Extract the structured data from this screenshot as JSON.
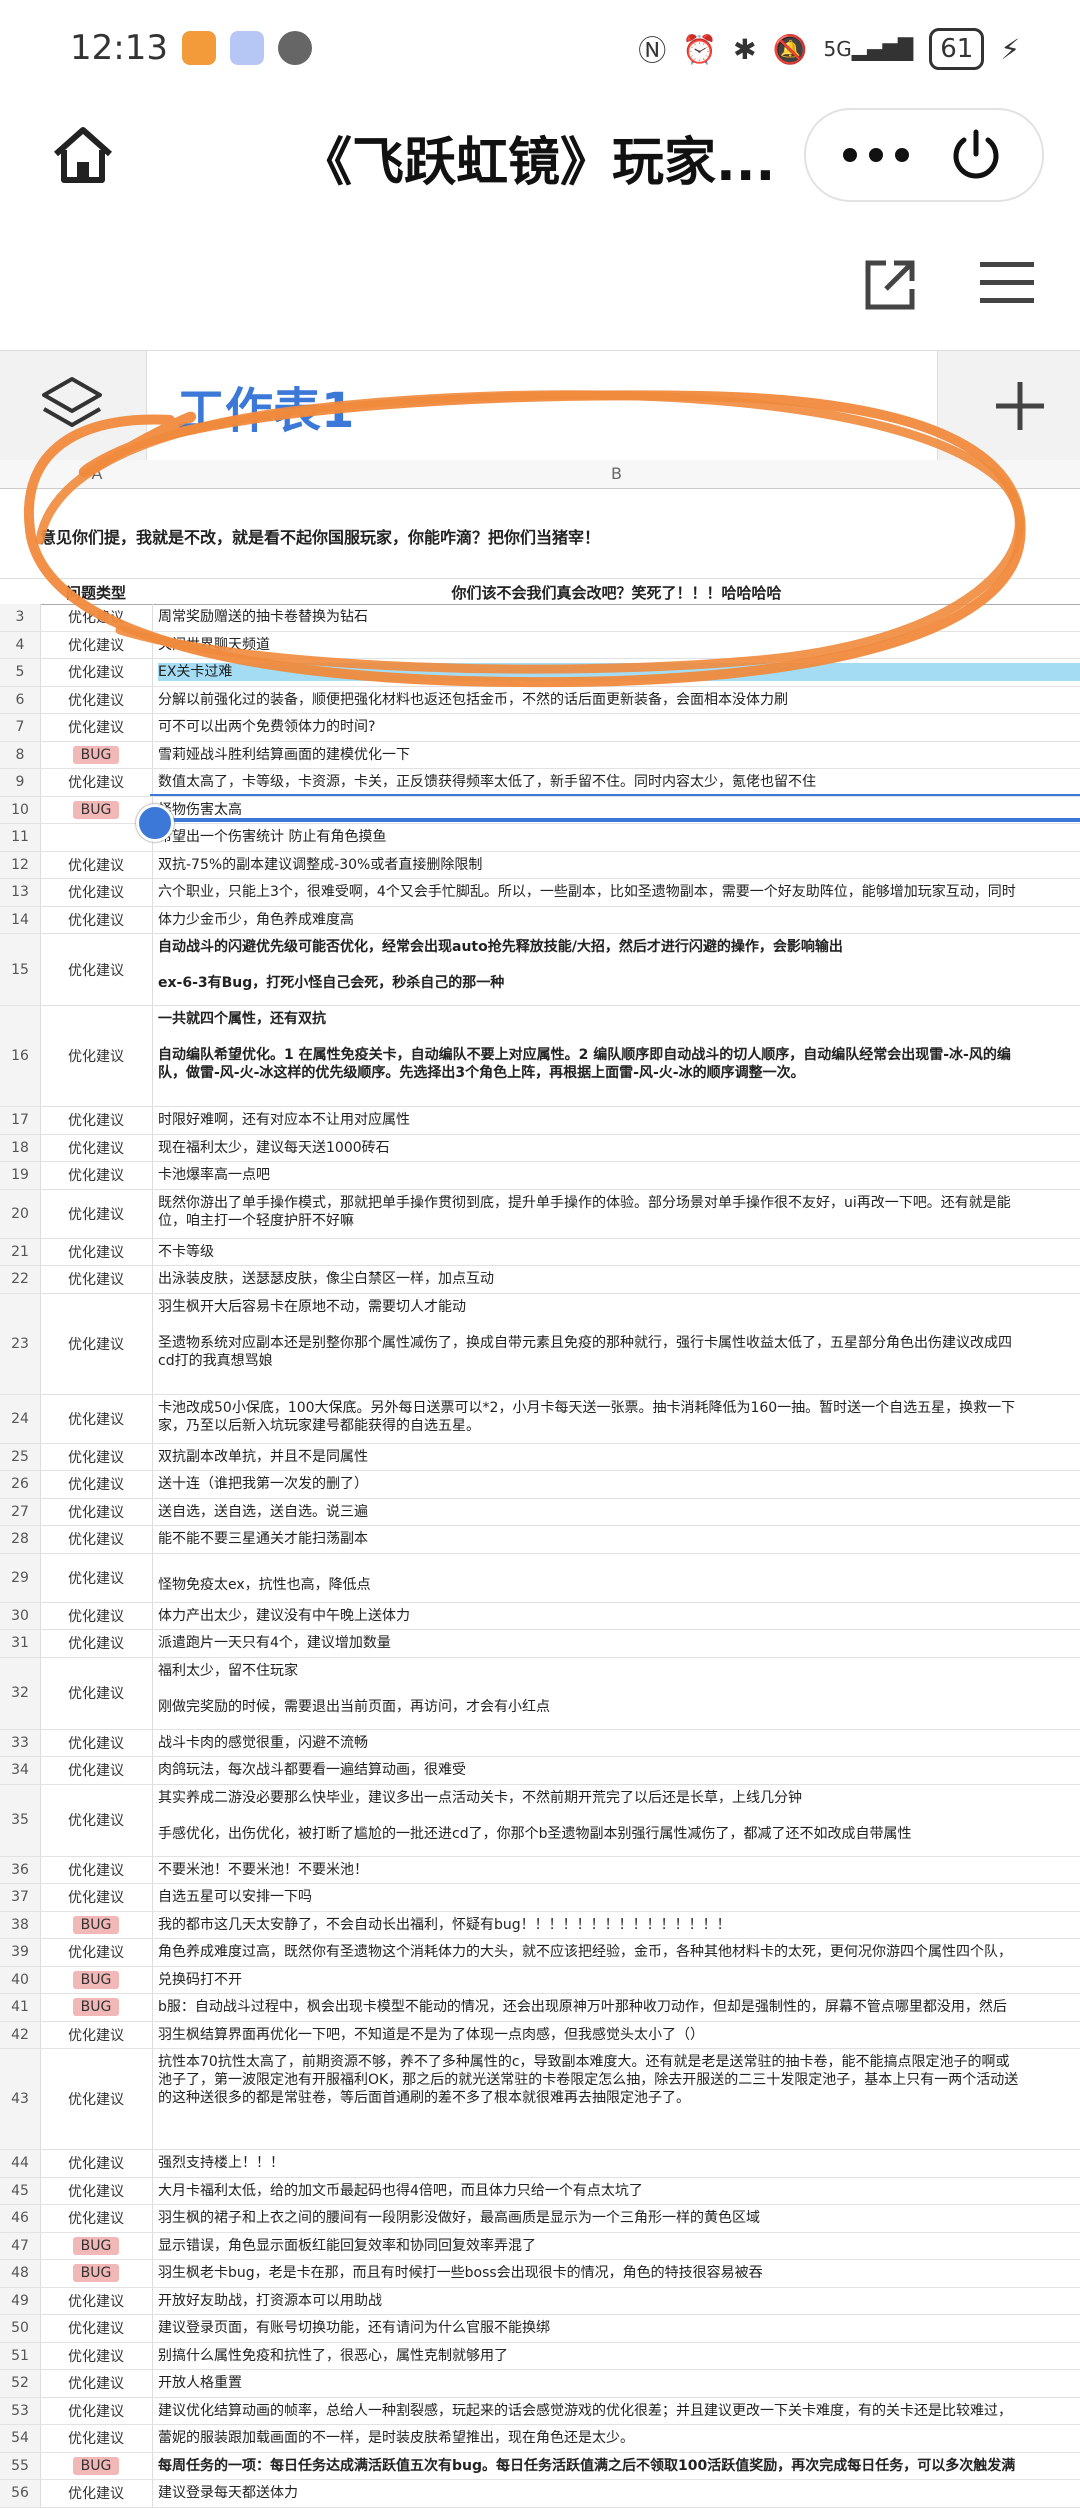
{
  "status": {
    "time": "12:13",
    "signal_label": "5G",
    "battery": "61"
  },
  "header": {
    "title": "《飞跃虹镜》玩家..."
  },
  "tabs": {
    "sheet_label": "工作表1"
  },
  "columns": {
    "a": "A",
    "b": "B"
  },
  "notice": "意见你们提，我就是不改，就是看不起你国服玩家，你能咋滴？把你们当猪宰！",
  "table_header": {
    "type": "问题类型",
    "content": "你们该不会我们真会改吧？笑死了！！！哈哈哈哈"
  },
  "rows": [
    {
      "n": "3",
      "type": "优化建议",
      "text": "周常奖励赠送的抽卡卷替换为钻石"
    },
    {
      "n": "4",
      "type": "优化建议",
      "text": "关闭世界聊天频道"
    },
    {
      "n": "5",
      "type": "优化建议",
      "text": "EX关卡过难"
    },
    {
      "n": "6",
      "type": "优化建议",
      "text": "分解以前强化过的装备，顺便把强化材料也返还包括金币，不然的话后面更新装备，会面相本没体力刷"
    },
    {
      "n": "7",
      "type": "优化建议",
      "text": "可不可以出两个免费领体力的时间?"
    },
    {
      "n": "8",
      "type": "BUG",
      "text": "雪莉娅战斗胜利结算画面的建模优化一下"
    },
    {
      "n": "9",
      "type": "优化建议",
      "text": "数值太高了，卡等级，卡资源，卡关，正反馈获得频率太低了，新手留不住。同时内容太少，氪佬也留不住"
    },
    {
      "n": "10",
      "type": "BUG",
      "text": "怪物伤害太高"
    },
    {
      "n": "11",
      "type": "",
      "text": "希望出一个伤害统计 防止有角色摸鱼"
    },
    {
      "n": "12",
      "type": "优化建议",
      "text": "双抗-75%的副本建议调整成-30%或者直接删除限制"
    },
    {
      "n": "13",
      "type": "优化建议",
      "text": "六个职业，只能上3个，很难受啊，4个又会手忙脚乱。所以，一些副本，比如圣遗物副本，需要一个好友助阵位，能够增加玩家互动，同时"
    },
    {
      "n": "14",
      "type": "优化建议",
      "text": "体力少金币少，角色养成难度高"
    },
    {
      "n": "15",
      "type": "优化建议",
      "text": "自动战斗的闪避优先级可能否优化，经常会出现auto抢先释放技能/大招，然后才进行闪避的操作，会影响输出\n\nex-6-3有Bug，打死小怪自己会死，秒杀自己的那一种",
      "bold": true,
      "tall": "t3"
    },
    {
      "n": "16",
      "type": "优化建议",
      "text": "一共就四个属性，还有双抗\n\n自动编队希望优化。1 在属性免疫关卡，自动编队不要上对应属性。2 编队顺序即自动战斗的切人顺序，自动编队经常会出现雷-冰-风的编\n队，做雷-风-火-冰这样的优先级顺序。先选择出3个角色上阵，再根据上面雷-风-火-冰的顺序调整一次。",
      "bold": true,
      "tall": "t4"
    },
    {
      "n": "17",
      "type": "优化建议",
      "text": "时限好难啊，还有对应本不让用对应属性"
    },
    {
      "n": "18",
      "type": "优化建议",
      "text": "现在福利太少，建议每天送1000砖石"
    },
    {
      "n": "19",
      "type": "优化建议",
      "text": "卡池爆率高一点吧"
    },
    {
      "n": "20",
      "type": "优化建议",
      "text": "既然你游出了单手操作模式，那就把单手操作贯彻到底，提升单手操作的体验。部分场景对单手操作很不友好，ui再改一下吧。还有就是能\n位，咱主打一个轻度护肝不好嘛",
      "tall": "t2"
    },
    {
      "n": "21",
      "type": "优化建议",
      "text": "不卡等级"
    },
    {
      "n": "22",
      "type": "优化建议",
      "text": "出泳装皮肤，送瑟瑟皮肤，像尘白禁区一样，加点互动"
    },
    {
      "n": "23",
      "type": "优化建议",
      "text": "羽生枫开大后容易卡在原地不动，需要切人才能动\n\n圣遗物系统对应副本还是别整你那个属性减伤了，换成自带元素且免疫的那种就行，强行卡属性收益太低了，五星部分角色出伤建议改成四\ncd打的我真想骂娘",
      "tall": "t4"
    },
    {
      "n": "24",
      "type": "优化建议",
      "text": "卡池改成50小保底，100大保底。另外每日送票可以*2，小月卡每天送一张票。抽卡消耗降低为160一抽。暂时送一个自选五星，换救一下\n家，乃至以后新入坑玩家建号都能获得的自选五星。",
      "tall": "t2"
    },
    {
      "n": "25",
      "type": "优化建议",
      "text": "双抗副本改单抗，并且不是同属性"
    },
    {
      "n": "26",
      "type": "优化建议",
      "text": "送十连（谁把我第一次发的删了）"
    },
    {
      "n": "27",
      "type": "优化建议",
      "text": "送自选，送自选，送自选。说三遍"
    },
    {
      "n": "28",
      "type": "优化建议",
      "text": "能不能不要三星通关才能扫荡副本"
    },
    {
      "n": "29",
      "type": "优化建议",
      "text": "\n怪物免疫太ex，抗性也高，降低点",
      "tall": "t2"
    },
    {
      "n": "30",
      "type": "优化建议",
      "text": "体力产出太少，建议没有中午晚上送体力"
    },
    {
      "n": "31",
      "type": "优化建议",
      "text": "派遣跑片一天只有4个，建议增加数量"
    },
    {
      "n": "32",
      "type": "优化建议",
      "text": "福利太少，留不住玩家\n\n刚做完奖励的时候，需要退出当前页面，再访问，才会有小红点",
      "tall": "t3"
    },
    {
      "n": "33",
      "type": "优化建议",
      "text": "战斗卡肉的感觉很重，闪避不流畅"
    },
    {
      "n": "34",
      "type": "优化建议",
      "text": "肉鸽玩法，每次战斗都要看一遍结算动画，很难受"
    },
    {
      "n": "35",
      "type": "优化建议",
      "text": "其实养成二游没必要那么快毕业，建议多出一点活动关卡，不然前期开荒完了以后还是长草，上线几分钟\n\n手感优化，出伤优化，被打断了尴尬的一批还进cd了，你那个b圣遗物副本别强行属性减伤了，都减了还不如改成自带属性",
      "tall": "t3"
    },
    {
      "n": "36",
      "type": "优化建议",
      "text": "不要米池！不要米池！不要米池！"
    },
    {
      "n": "37",
      "type": "优化建议",
      "text": "自选五星可以安排一下吗"
    },
    {
      "n": "38",
      "type": "BUG",
      "text": "我的都市这几天太安静了，不会自动长出福利，怀疑有bug！！！！！！！！！！！！！！！"
    },
    {
      "n": "39",
      "type": "优化建议",
      "text": "角色养成难度过高，既然你有圣遗物这个消耗体力的大头，就不应该把经验，金币，各种其他材料卡的太死，更何况你游四个属性四个队，"
    },
    {
      "n": "40",
      "type": "BUG",
      "text": "兑换码打不开"
    },
    {
      "n": "41",
      "type": "BUG",
      "text": "b服：自动战斗过程中，枫会出现卡模型不能动的情况，还会出现原神万叶那种收刀动作，但却是强制性的，屏幕不管点哪里都没用，然后"
    },
    {
      "n": "42",
      "type": "优化建议",
      "text": "羽生枫结算界面再优化一下吧，不知道是不是为了体现一点肉感，但我感觉头太小了（）"
    },
    {
      "n": "43",
      "type": "优化建议",
      "text": "抗性本70抗性太高了，前期资源不够，养不了多种属性的c，导致副本难度大。还有就是老是送常驻的抽卡卷，能不能搞点限定池子的啊或\n池子了，第一波限定池有开服福利OK，那之后的就光送常驻的卡卷限定怎么抽，除去开服送的二三十发限定池子，基本上只有一两个活动送\n的这种送很多的都是常驻卷，等后面首通刷的差不多了根本就很难再去抽限定池子了。",
      "tall": "t4"
    },
    {
      "n": "44",
      "type": "优化建议",
      "text": "强烈支持楼上！！！"
    },
    {
      "n": "45",
      "type": "优化建议",
      "text": "大月卡福利太低，给的加文币最起码也得4倍吧，而且体力只给一个有点太坑了"
    },
    {
      "n": "46",
      "type": "优化建议",
      "text": "羽生枫的裙子和上衣之间的腰间有一段阴影没做好，最高画质是显示为一个三角形一样的黄色区域"
    },
    {
      "n": "47",
      "type": "BUG",
      "text": "显示错误，角色显示面板红能回复效率和协同回复效率弄混了"
    },
    {
      "n": "48",
      "type": "BUG",
      "text": "羽生枫老卡bug，老是卡在那，而且有时候打一些boss会出现很卡的情况，角色的特技很容易被吞"
    },
    {
      "n": "49",
      "type": "优化建议",
      "text": "开放好友助战，打资源本可以用助战"
    },
    {
      "n": "50",
      "type": "优化建议",
      "text": "建议登录页面，有账号切换功能，还有请问为什么官服不能换绑"
    },
    {
      "n": "51",
      "type": "优化建议",
      "text": "别搞什么属性免疫和抗性了，很恶心，属性克制就够用了"
    },
    {
      "n": "52",
      "type": "优化建议",
      "text": "开放人格重置"
    },
    {
      "n": "53",
      "type": "优化建议",
      "text": "建议优化结算动画的帧率，总给人一种割裂感，玩起来的话会感觉游戏的优化很差；并且建议更改一下关卡难度，有的关卡还是比较难过，"
    },
    {
      "n": "54",
      "type": "优化建议",
      "text": "蕾妮的服装跟加载画面的不一样，是时装皮肤希望推出，现在角色还是太少。"
    },
    {
      "n": "55",
      "type": "BUG",
      "text": "每周任务的一项：每日任务达成满活跃值五次有bug。每日任务活跃值满之后不领取100活跃值奖励，再次完成每日任务，可以多次触发满",
      "bold": true
    },
    {
      "n": "56",
      "type": "优化建议",
      "text": "建议登录每天都送体力"
    }
  ]
}
